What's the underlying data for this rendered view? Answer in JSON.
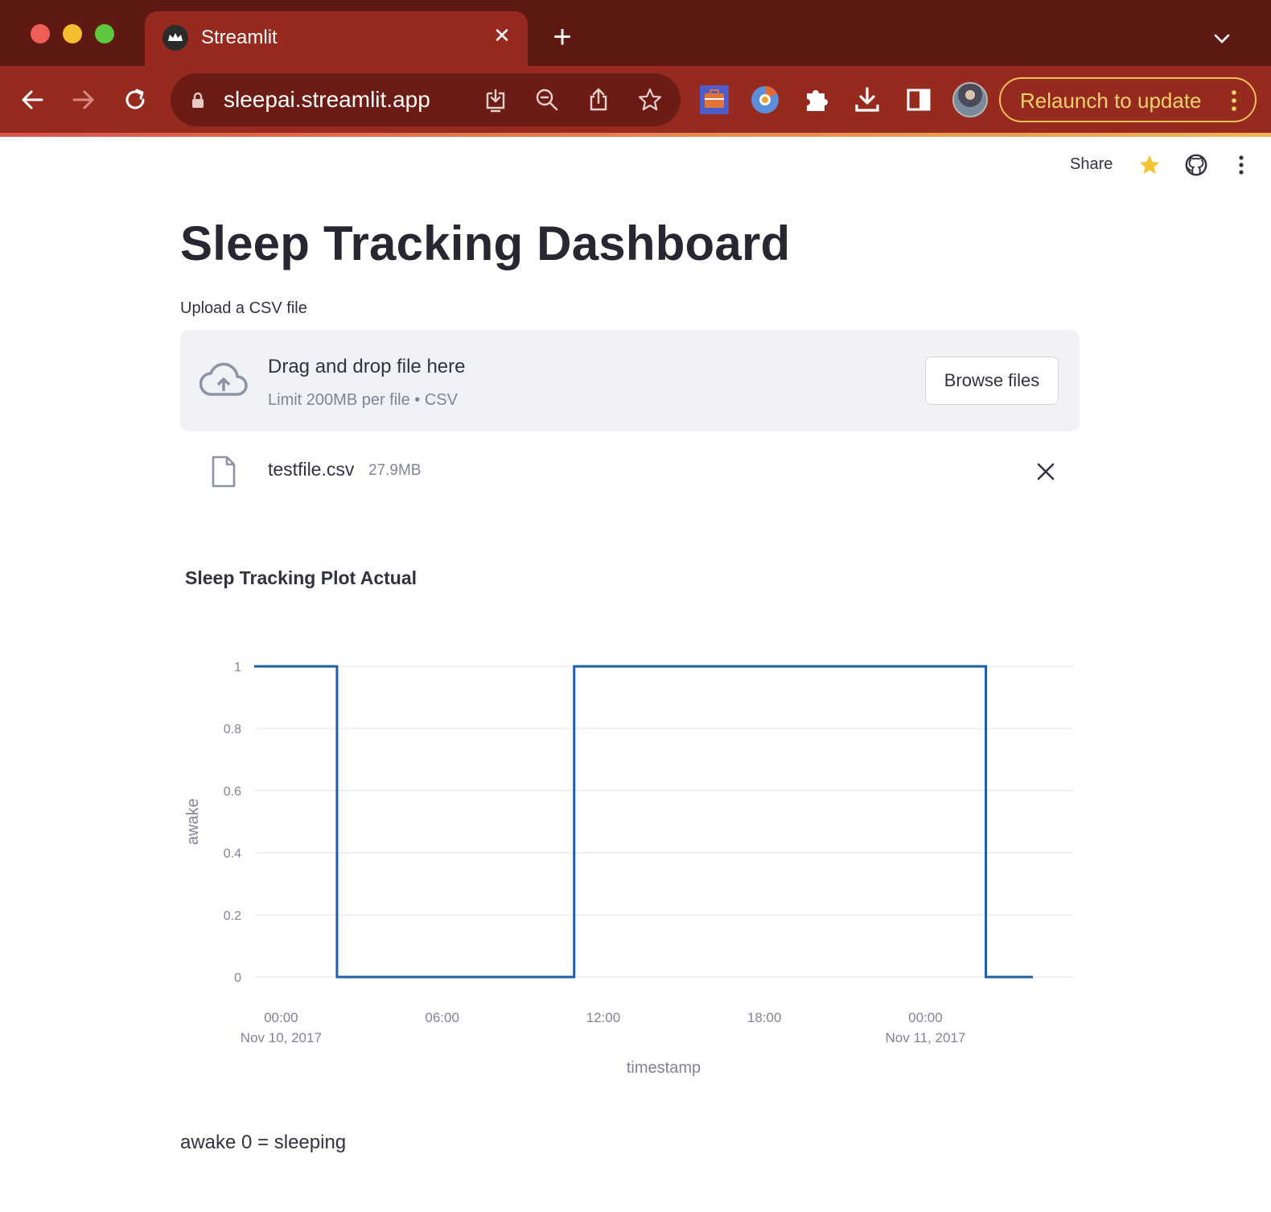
{
  "browser": {
    "tab_title": "Streamlit",
    "tab_close": "✕",
    "new_tab": "+",
    "url": "sleepai.streamlit.app",
    "relaunch_label": "Relaunch to update",
    "icons": [
      "back-icon",
      "forward-icon",
      "reload-icon",
      "lock-icon",
      "install-app-icon",
      "zoom-icon",
      "share-page-icon",
      "bookmark-star-icon",
      "briefcase-extension-icon",
      "chromium-extension-icon",
      "puzzle-extensions-icon",
      "downloads-icon",
      "side-panel-icon",
      "profile-avatar",
      "kebab-menu-icon"
    ],
    "colors": {
      "tabbar": "#5e1912",
      "toolbar": "#962a1f",
      "relaunch_accent": "#f2c15a"
    }
  },
  "header": {
    "share_label": "Share"
  },
  "main": {
    "title": "Sleep Tracking Dashboard",
    "uploader": {
      "label": "Upload a CSV file",
      "instructions": "Drag and drop file here",
      "limit": "Limit 200MB per file • CSV",
      "browse_label": "Browse files"
    },
    "file": {
      "name": "testfile.csv",
      "size": "27.9MB"
    },
    "chart_heading": "Sleep Tracking Plot Actual",
    "note": "awake 0 = sleeping"
  },
  "chart_data": {
    "type": "line",
    "interpolation": "step",
    "xlabel": "timestamp",
    "ylabel": "awake",
    "ylim": [
      0,
      1
    ],
    "grid": true,
    "x_range": [
      "2017-11-09 23:00",
      "2017-11-11 05:30"
    ],
    "y_ticks": [
      "0",
      "0.2",
      "0.4",
      "0.6",
      "0.8",
      "1"
    ],
    "x_ticks": [
      {
        "at": "2017-11-10 00:00",
        "line1": "00:00",
        "line2": "Nov 10, 2017"
      },
      {
        "at": "2017-11-10 06:00",
        "line1": "06:00",
        "line2": ""
      },
      {
        "at": "2017-11-10 12:00",
        "line1": "12:00",
        "line2": ""
      },
      {
        "at": "2017-11-10 18:00",
        "line1": "18:00",
        "line2": ""
      },
      {
        "at": "2017-11-11 00:00",
        "line1": "00:00",
        "line2": "Nov 11, 2017"
      }
    ],
    "series": [
      {
        "x": [
          "2017-11-09 23:00",
          "2017-11-10 02:05",
          "2017-11-10 10:55",
          "2017-11-11 02:15",
          "2017-11-11 04:00"
        ],
        "y": [
          1,
          0,
          1,
          0,
          0
        ],
        "color": "#1f5ea8"
      }
    ]
  }
}
